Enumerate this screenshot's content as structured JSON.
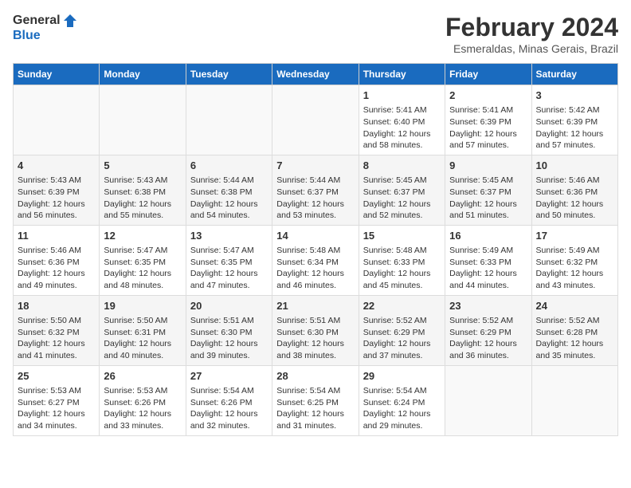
{
  "logo": {
    "line1": "General",
    "line2": "Blue"
  },
  "title": "February 2024",
  "subtitle": "Esmeraldas, Minas Gerais, Brazil",
  "days_header": [
    "Sunday",
    "Monday",
    "Tuesday",
    "Wednesday",
    "Thursday",
    "Friday",
    "Saturday"
  ],
  "weeks": [
    [
      {
        "day": "",
        "info": ""
      },
      {
        "day": "",
        "info": ""
      },
      {
        "day": "",
        "info": ""
      },
      {
        "day": "",
        "info": ""
      },
      {
        "day": "1",
        "info": "Sunrise: 5:41 AM\nSunset: 6:40 PM\nDaylight: 12 hours\nand 58 minutes."
      },
      {
        "day": "2",
        "info": "Sunrise: 5:41 AM\nSunset: 6:39 PM\nDaylight: 12 hours\nand 57 minutes."
      },
      {
        "day": "3",
        "info": "Sunrise: 5:42 AM\nSunset: 6:39 PM\nDaylight: 12 hours\nand 57 minutes."
      }
    ],
    [
      {
        "day": "4",
        "info": "Sunrise: 5:43 AM\nSunset: 6:39 PM\nDaylight: 12 hours\nand 56 minutes."
      },
      {
        "day": "5",
        "info": "Sunrise: 5:43 AM\nSunset: 6:38 PM\nDaylight: 12 hours\nand 55 minutes."
      },
      {
        "day": "6",
        "info": "Sunrise: 5:44 AM\nSunset: 6:38 PM\nDaylight: 12 hours\nand 54 minutes."
      },
      {
        "day": "7",
        "info": "Sunrise: 5:44 AM\nSunset: 6:37 PM\nDaylight: 12 hours\nand 53 minutes."
      },
      {
        "day": "8",
        "info": "Sunrise: 5:45 AM\nSunset: 6:37 PM\nDaylight: 12 hours\nand 52 minutes."
      },
      {
        "day": "9",
        "info": "Sunrise: 5:45 AM\nSunset: 6:37 PM\nDaylight: 12 hours\nand 51 minutes."
      },
      {
        "day": "10",
        "info": "Sunrise: 5:46 AM\nSunset: 6:36 PM\nDaylight: 12 hours\nand 50 minutes."
      }
    ],
    [
      {
        "day": "11",
        "info": "Sunrise: 5:46 AM\nSunset: 6:36 PM\nDaylight: 12 hours\nand 49 minutes."
      },
      {
        "day": "12",
        "info": "Sunrise: 5:47 AM\nSunset: 6:35 PM\nDaylight: 12 hours\nand 48 minutes."
      },
      {
        "day": "13",
        "info": "Sunrise: 5:47 AM\nSunset: 6:35 PM\nDaylight: 12 hours\nand 47 minutes."
      },
      {
        "day": "14",
        "info": "Sunrise: 5:48 AM\nSunset: 6:34 PM\nDaylight: 12 hours\nand 46 minutes."
      },
      {
        "day": "15",
        "info": "Sunrise: 5:48 AM\nSunset: 6:33 PM\nDaylight: 12 hours\nand 45 minutes."
      },
      {
        "day": "16",
        "info": "Sunrise: 5:49 AM\nSunset: 6:33 PM\nDaylight: 12 hours\nand 44 minutes."
      },
      {
        "day": "17",
        "info": "Sunrise: 5:49 AM\nSunset: 6:32 PM\nDaylight: 12 hours\nand 43 minutes."
      }
    ],
    [
      {
        "day": "18",
        "info": "Sunrise: 5:50 AM\nSunset: 6:32 PM\nDaylight: 12 hours\nand 41 minutes."
      },
      {
        "day": "19",
        "info": "Sunrise: 5:50 AM\nSunset: 6:31 PM\nDaylight: 12 hours\nand 40 minutes."
      },
      {
        "day": "20",
        "info": "Sunrise: 5:51 AM\nSunset: 6:30 PM\nDaylight: 12 hours\nand 39 minutes."
      },
      {
        "day": "21",
        "info": "Sunrise: 5:51 AM\nSunset: 6:30 PM\nDaylight: 12 hours\nand 38 minutes."
      },
      {
        "day": "22",
        "info": "Sunrise: 5:52 AM\nSunset: 6:29 PM\nDaylight: 12 hours\nand 37 minutes."
      },
      {
        "day": "23",
        "info": "Sunrise: 5:52 AM\nSunset: 6:29 PM\nDaylight: 12 hours\nand 36 minutes."
      },
      {
        "day": "24",
        "info": "Sunrise: 5:52 AM\nSunset: 6:28 PM\nDaylight: 12 hours\nand 35 minutes."
      }
    ],
    [
      {
        "day": "25",
        "info": "Sunrise: 5:53 AM\nSunset: 6:27 PM\nDaylight: 12 hours\nand 34 minutes."
      },
      {
        "day": "26",
        "info": "Sunrise: 5:53 AM\nSunset: 6:26 PM\nDaylight: 12 hours\nand 33 minutes."
      },
      {
        "day": "27",
        "info": "Sunrise: 5:54 AM\nSunset: 6:26 PM\nDaylight: 12 hours\nand 32 minutes."
      },
      {
        "day": "28",
        "info": "Sunrise: 5:54 AM\nSunset: 6:25 PM\nDaylight: 12 hours\nand 31 minutes."
      },
      {
        "day": "29",
        "info": "Sunrise: 5:54 AM\nSunset: 6:24 PM\nDaylight: 12 hours\nand 29 minutes."
      },
      {
        "day": "",
        "info": ""
      },
      {
        "day": "",
        "info": ""
      }
    ]
  ]
}
